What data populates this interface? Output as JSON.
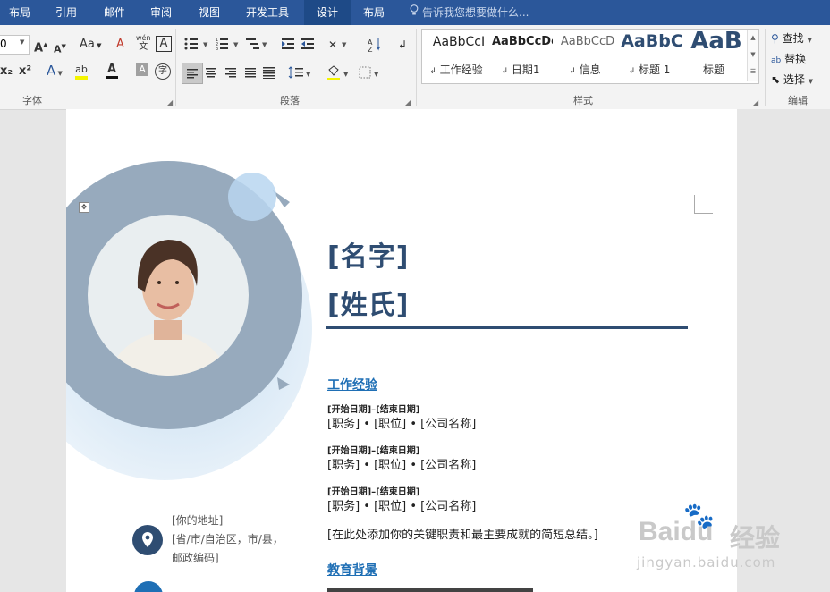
{
  "ribbon_tabs": [
    {
      "label": "布局"
    },
    {
      "label": "引用"
    },
    {
      "label": "邮件"
    },
    {
      "label": "审阅"
    },
    {
      "label": "视图"
    },
    {
      "label": "开发工具"
    },
    {
      "label": "设计"
    },
    {
      "label": "布局"
    }
  ],
  "tell_me": "告诉我您想要做什么...",
  "font_group": {
    "size_fragment": "0",
    "grow": "A",
    "shrink": "A",
    "change_case": "Aa",
    "clear_format": "A",
    "phonetic": "wén",
    "border_char": "A",
    "subscript": "x₂",
    "superscript": "x²",
    "text_effect": "A",
    "highlight": "ab",
    "font_color": "A",
    "char_shade": "A",
    "enclose": "字",
    "label": "字体"
  },
  "paragraph_group": {
    "label": "段落"
  },
  "styles_group": {
    "label": "样式",
    "items": [
      {
        "sample": "AaBbCcI",
        "name": "工作经验"
      },
      {
        "sample": "AaBbCcDc",
        "name": "日期1"
      },
      {
        "sample": "AaBbCcD",
        "name": "信息"
      },
      {
        "sample": "AaBbC",
        "name": "标题 1"
      },
      {
        "sample": "AaB",
        "name": "标题"
      }
    ]
  },
  "editing_group": {
    "find": "查找",
    "replace": "替换",
    "select": "选择",
    "label": "编辑"
  },
  "document": {
    "first_name": "[名字]",
    "last_name": "[姓氏]",
    "experience_heading": "工作经验",
    "experiences": [
      {
        "dates": "[开始日期]–[结束日期]",
        "role": "[职务] • [职位] • [公司名称]"
      },
      {
        "dates": "[开始日期]–[结束日期]",
        "role": "[职务] • [职位] • [公司名称]"
      },
      {
        "dates": "[开始日期]–[结束日期]",
        "role": "[职务] • [职位] • [公司名称]"
      }
    ],
    "summary": "[在此处添加你的关键职责和最主要成就的简短总结。]",
    "education_heading": "教育背景",
    "address_line1": "[你的地址]",
    "address_line2": "[省/市/自治区，市/县，",
    "address_line3": "邮政编码]"
  },
  "watermark": {
    "brand": "Baidu",
    "cn": "经验",
    "url": "jingyan.baidu.com"
  },
  "colors": {
    "ribbon_blue": "#2b579a",
    "title_navy": "#2f4d72",
    "heading_blue": "#1f6fb5",
    "ring_gray": "#97aabd",
    "wash_blue": "#c4dcf0"
  }
}
